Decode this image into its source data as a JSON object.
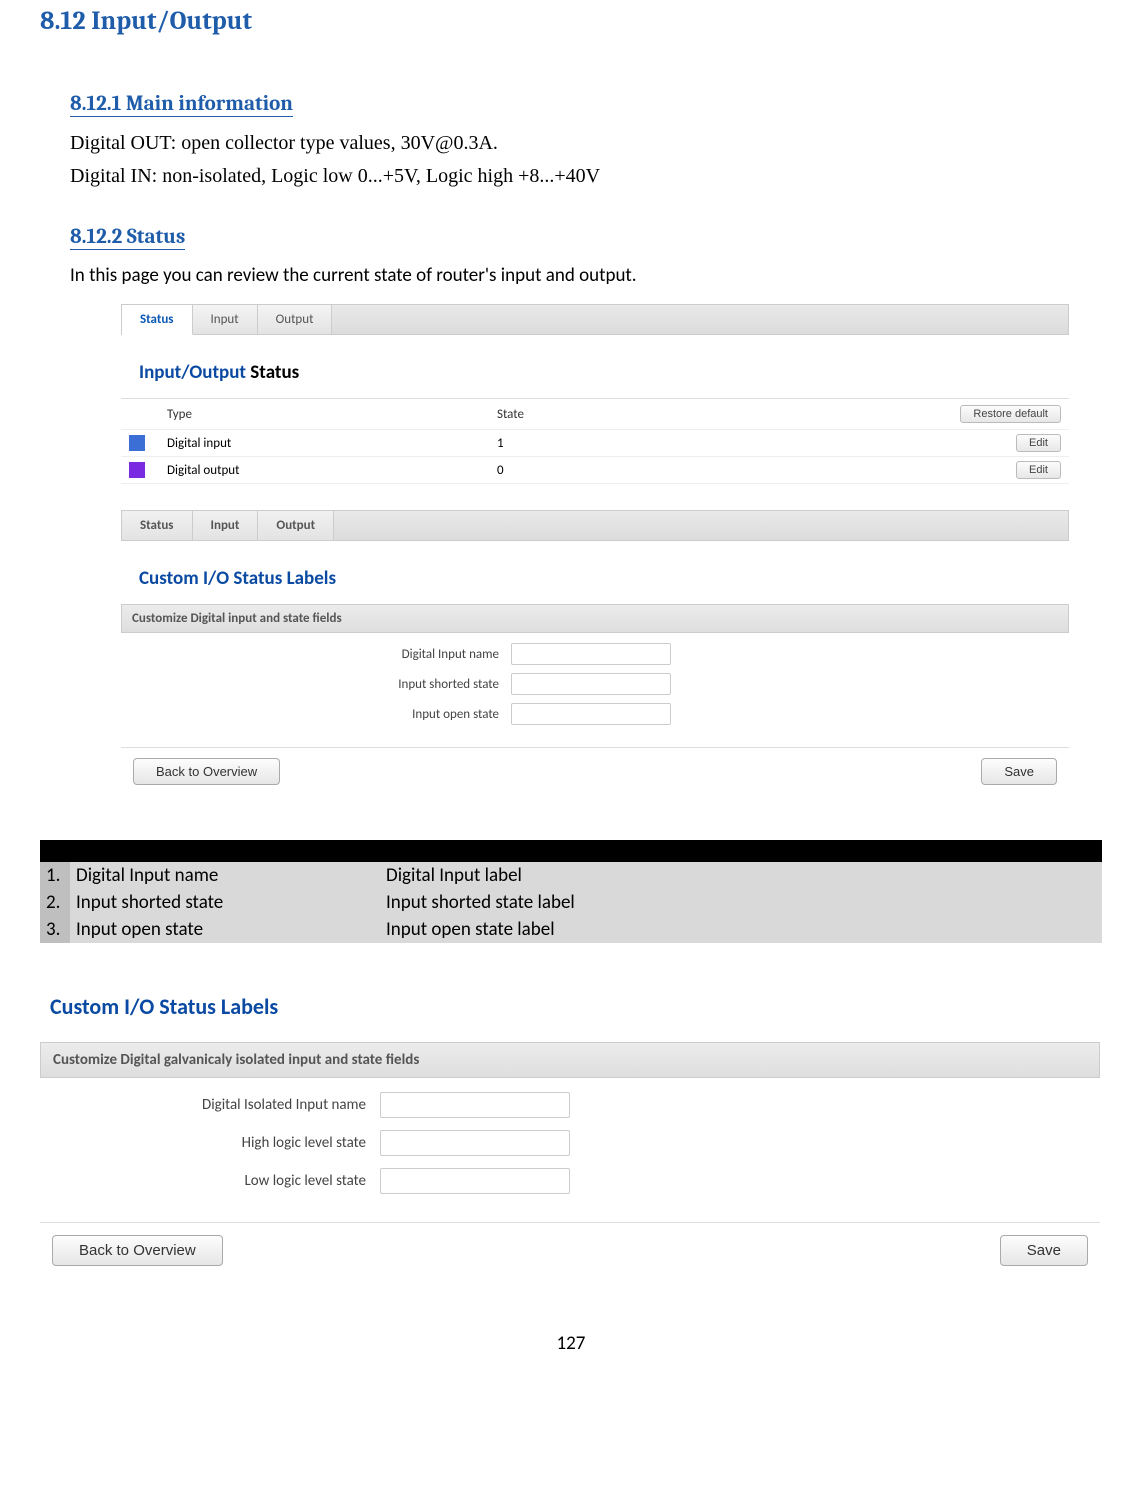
{
  "headings": {
    "h1": "8.12 Input/Output",
    "h2a": "8.12.1 Main information",
    "h2b": "8.12.2 Status"
  },
  "body": {
    "line1": "Digital OUT: open collector type values, 30V@0.3A.",
    "line2": "Digital IN: non-isolated, Logic low 0...+5V, Logic high +8...+40V",
    "status_intro": "In this page you can review the current state of router's input and output."
  },
  "shot1": {
    "tabs": {
      "t0": "Status",
      "t1": "Input",
      "t2": "Output"
    },
    "title_blue": "Input/Output",
    "title_black": " Status",
    "header_type": "Type",
    "header_state": "State",
    "restore_btn": "Restore default",
    "rows": [
      {
        "type": "Digital input",
        "state": "1",
        "btn": "Edit"
      },
      {
        "type": "Digital output",
        "state": "0",
        "btn": "Edit"
      }
    ],
    "tabs2": {
      "t0": "Status",
      "t1": "Input",
      "t2": "Output"
    },
    "title2": "Custom I/O Status Labels",
    "section_bar": "Customize Digital input and state fields",
    "fields": {
      "f0": "Digital Input name",
      "f1": "Input shorted state",
      "f2": "Input open state"
    },
    "back": "Back to Overview",
    "save": "Save"
  },
  "desc_table": {
    "rows": [
      {
        "n": "1.",
        "a": "Digital Input name",
        "b": "Digital Input label"
      },
      {
        "n": "2.",
        "a": "Input shorted state",
        "b": "Input shorted state label"
      },
      {
        "n": "3.",
        "a": "Input open state",
        "b": "Input open state label"
      }
    ]
  },
  "shot2": {
    "title": "Custom I/O Status Labels",
    "section_bar": "Customize Digital galvanicaly isolated input and state fields",
    "fields": {
      "f0": "Digital Isolated Input name",
      "f1": "High logic level state",
      "f2": "Low logic level state"
    },
    "back": "Back to Overview",
    "save": "Save"
  },
  "page_number": "127"
}
